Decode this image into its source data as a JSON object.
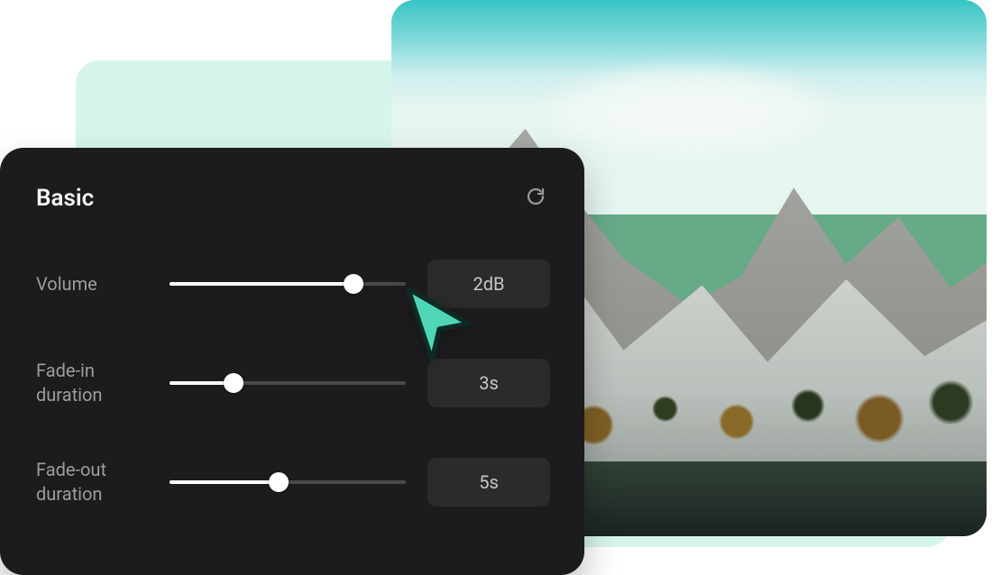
{
  "panel": {
    "title": "Basic",
    "reset_icon": "reset-icon",
    "rows": [
      {
        "label": "Volume",
        "value": "2dB",
        "percent": 78
      },
      {
        "label": "Fade-in\nduration",
        "value": "3s",
        "percent": 27
      },
      {
        "label": "Fade-out\nduration",
        "value": "5s",
        "percent": 46
      }
    ]
  },
  "colors": {
    "accent": "#4fd1b3"
  }
}
